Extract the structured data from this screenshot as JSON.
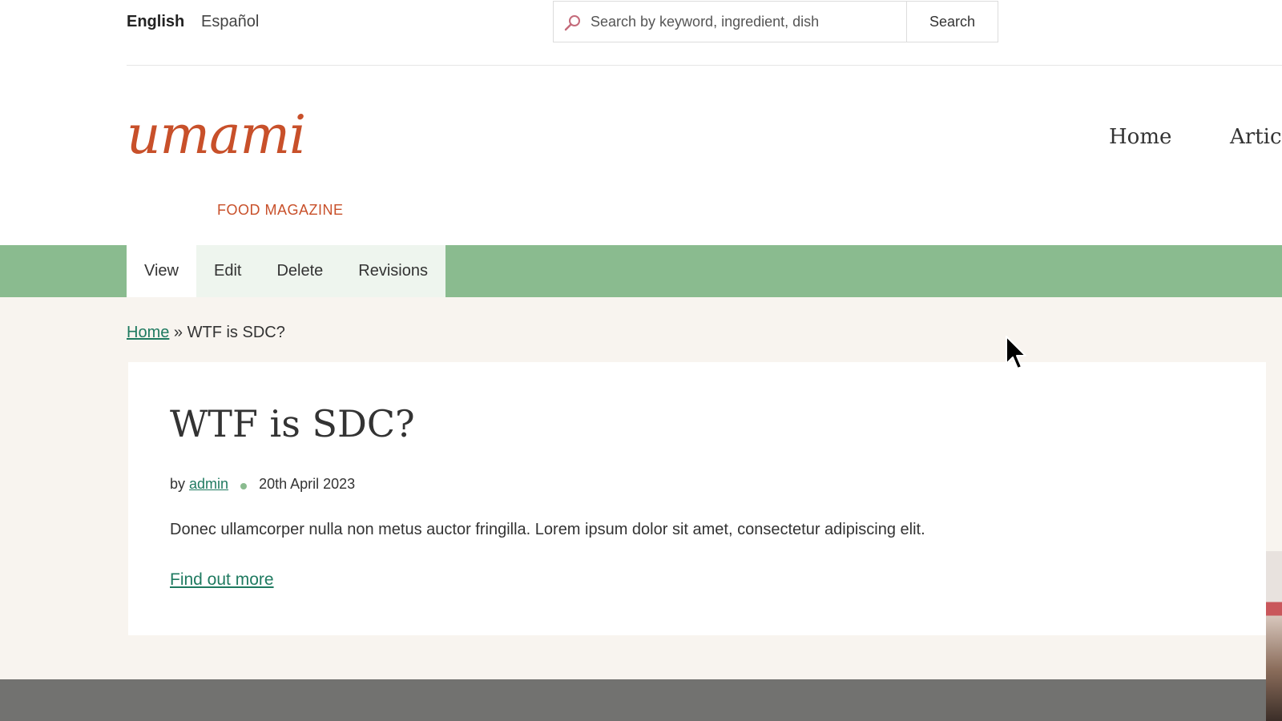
{
  "languages": {
    "english": "English",
    "espanol": "Español"
  },
  "search": {
    "placeholder": "Search by keyword, ingredient, dish",
    "button_label": "Search"
  },
  "logo": {
    "word": "umami",
    "subtitle": "FOOD MAGAZINE"
  },
  "main_nav": {
    "home": "Home",
    "articles": "Articl"
  },
  "tabs": [
    {
      "label": "View",
      "active": true
    },
    {
      "label": "Edit",
      "active": false
    },
    {
      "label": "Delete",
      "active": false
    },
    {
      "label": "Revisions",
      "active": false
    }
  ],
  "breadcrumb": {
    "home": "Home",
    "separator": "»",
    "current": "WTF is SDC?"
  },
  "article": {
    "title": "WTF is SDC?",
    "by": "by",
    "author": "admin",
    "date": "20th April 2023",
    "summary": "Donec ullamcorper nulla non metus auctor fringilla. Lorem ipsum dolor sit amet, consectetur adipiscing elit.",
    "link": "Find out more"
  },
  "colors": {
    "brand": "#c8502a",
    "tab_band": "#8abb8f",
    "link": "#1f7a60",
    "page_bg": "#f8f4ef",
    "footer": "#727270"
  },
  "icons": {
    "search": "magnifier-icon",
    "cursor": "mouse-pointer-icon"
  }
}
